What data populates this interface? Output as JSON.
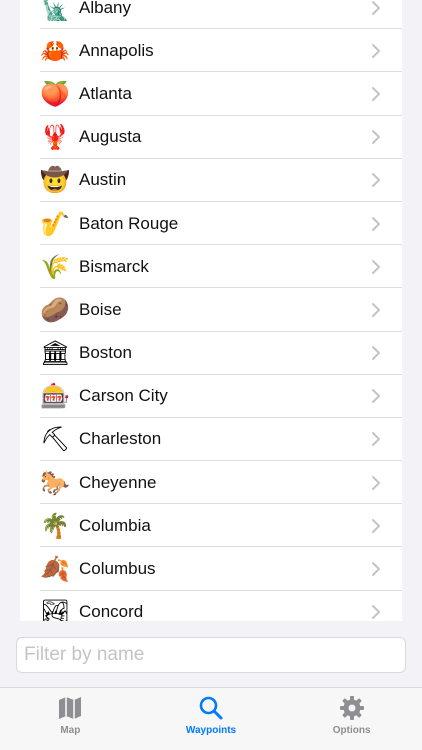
{
  "waypoints": [
    {
      "name": "Albany",
      "icon": "statue-of-liberty-icon",
      "glyph": "🗽"
    },
    {
      "name": "Annapolis",
      "icon": "crab-icon",
      "glyph": "🦀"
    },
    {
      "name": "Atlanta",
      "icon": "peach-icon",
      "glyph": "🍑"
    },
    {
      "name": "Augusta",
      "icon": "lobster-icon",
      "glyph": "🦞"
    },
    {
      "name": "Austin",
      "icon": "cowboy-face-icon",
      "glyph": "🤠"
    },
    {
      "name": "Baton Rouge",
      "icon": "saxophone-icon",
      "glyph": "🎷"
    },
    {
      "name": "Bismarck",
      "icon": "wheat-icon",
      "glyph": "🌾"
    },
    {
      "name": "Boise",
      "icon": "potato-icon",
      "glyph": "🥔"
    },
    {
      "name": "Boston",
      "icon": "classical-building-icon",
      "glyph": "🏛"
    },
    {
      "name": "Carson City",
      "icon": "slot-machine-icon",
      "glyph": "🎰"
    },
    {
      "name": "Charleston",
      "icon": "pick-icon",
      "glyph": "⛏"
    },
    {
      "name": "Cheyenne",
      "icon": "horse-icon",
      "glyph": "🐎"
    },
    {
      "name": "Columbia",
      "icon": "palm-tree-icon",
      "glyph": "🌴"
    },
    {
      "name": "Columbus",
      "icon": "fallen-leaves-icon",
      "glyph": "🍂"
    },
    {
      "name": "Concord",
      "icon": "mountain-lake-icon",
      "glyph": "🏞"
    }
  ],
  "filter": {
    "placeholder": "Filter by name",
    "value": ""
  },
  "tabs": [
    {
      "label": "Map",
      "icon": "map-icon",
      "active": false
    },
    {
      "label": "Waypoints",
      "icon": "search-icon",
      "active": true
    },
    {
      "label": "Options",
      "icon": "gear-icon",
      "active": false
    }
  ],
  "colors": {
    "accent": "#007aff",
    "inactive": "#8e8e93",
    "background": "#f2f2f7"
  }
}
